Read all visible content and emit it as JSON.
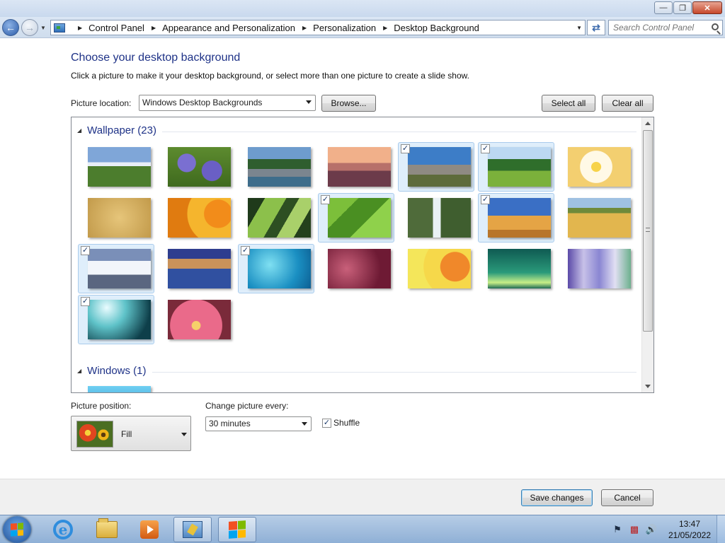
{
  "window": {
    "controls": {
      "minimize": "—",
      "maximize": "❐",
      "close": "✕"
    }
  },
  "address": {
    "breadcrumbs": [
      "Control Panel",
      "Appearance and Personalization",
      "Personalization",
      "Desktop Background"
    ],
    "search_placeholder": "Search Control Panel"
  },
  "page": {
    "title": "Choose your desktop background",
    "subtitle": "Click a picture to make it your desktop background, or select more than one picture to create a slide show.",
    "picture_location_label": "Picture location:",
    "picture_location_value": "Windows Desktop Backgrounds",
    "browse_label": "Browse...",
    "select_all_label": "Select all",
    "clear_all_label": "Clear all"
  },
  "groups": [
    {
      "label": "Wallpaper (23)",
      "items": [
        {
          "name": "stone-circle",
          "checked": false,
          "bg": "linear-gradient(#7fa6d8 0 38%, #e7eef7 38% 48%, #4c7d2d 48% 100%)"
        },
        {
          "name": "bluebells",
          "checked": false,
          "bg": "radial-gradient(circle at 30% 40%, #7a6fd1 0 18%, transparent 19%), radial-gradient(circle at 70% 60%, #6a5fc5 0 20%, transparent 21%), linear-gradient(#5d8b2f, #3f6a1e)"
        },
        {
          "name": "stone-bridge",
          "checked": false,
          "bg": "linear-gradient(#6e9ccd 0 30%, #2f5e2f 30% 55%, #7b858f 55% 75%, #3e6d8b 75%)"
        },
        {
          "name": "pebble-beach",
          "checked": false,
          "bg": "linear-gradient(#f1b08a 0 40%, #b7706a 40% 60%, #6c3b4a 60%)"
        },
        {
          "name": "dolmen",
          "checked": true,
          "bg": "linear-gradient(#3d7dc7 0 45%, #8f8a83 45% 70%, #5e6b3b 70%)"
        },
        {
          "name": "green-valley",
          "checked": true,
          "bg": "linear-gradient(#bcd8f2 0 30%, #2f6e2b 30% 60%, #7bb13b 60%)"
        },
        {
          "name": "frangipani",
          "checked": false,
          "bg": "radial-gradient(circle at 45% 50%, #f7d34a 0 12%, #fff9e6 13% 40%, #f3cf70 41% 100%)"
        },
        {
          "name": "golden-texture",
          "checked": false,
          "bg": "radial-gradient(circle at 50% 50%, #e6c57a, #c29a4a)"
        },
        {
          "name": "orange-flower",
          "checked": false,
          "bg": "radial-gradient(circle at 80% 40%, #f28c1a 0 25%, #f5b52d 26% 55%, #e07b10 56%)"
        },
        {
          "name": "agave-leaves",
          "checked": false,
          "bg": "linear-gradient(120deg, #1f3a1b 0 20%, #8cc04b 20% 45%, #2d4f22 45% 60%, #a9d06a 60% 80%, #24401c 80%)"
        },
        {
          "name": "fern",
          "checked": true,
          "bg": "linear-gradient(135deg, #7cbf3a 0 30%, #4a8f22 30% 60%, #8fd14b 60%)"
        },
        {
          "name": "waterfall",
          "checked": false,
          "bg": "linear-gradient(90deg, #4f6b3a 0 40%, #e9f1f4 40% 52%, #3f5e2f 52%)"
        },
        {
          "name": "desert-dune",
          "checked": true,
          "bg": "linear-gradient(#3a6fc5 0 45%, #e5a445 45% 80%, #b8752a 80%)"
        },
        {
          "name": "wheat-field",
          "checked": false,
          "bg": "linear-gradient(#9fc1e2 0 25%, #6f8a3a 25% 38%, #e2b64e 38%)"
        },
        {
          "name": "snow-mountains",
          "checked": true,
          "bg": "linear-gradient(#7a8fb8 0 30%, #f2f5fa 30% 65%, #5a6680 65%)"
        },
        {
          "name": "mountain-lake",
          "checked": false,
          "bg": "linear-gradient(#2e3d8f 0 25%, #c9925a 25% 50%, #3050a0 50%)"
        },
        {
          "name": "underwater-blue",
          "checked": true,
          "bg": "radial-gradient(circle at 35% 40%, #7fe0f2, #1a8fc2 60%, #0d5f93)"
        },
        {
          "name": "aurora-maroon",
          "checked": false,
          "bg": "radial-gradient(circle at 30% 50%, #c9607a, #6e1a34 70%)"
        },
        {
          "name": "yellow-orange-bokeh",
          "checked": false,
          "bg": "radial-gradient(circle at 75% 45%, #f0882a 0 28%, #f6d84a 29% 60%, #f4e65a 61%)"
        },
        {
          "name": "green-aurora",
          "checked": false,
          "bg": "linear-gradient(#0f5a52, #2a9a7a 60%, #c8ef88 85%, #1f6b55)"
        },
        {
          "name": "purple-stripes",
          "checked": false,
          "bg": "linear-gradient(90deg, #5b4aa8, #c7c1e8, #8a86d2, #e1dff3, #6db08e)"
        },
        {
          "name": "teal-light",
          "checked": true,
          "bg": "radial-gradient(circle at 30% 20%, #eafcff, #5fc3c9 35%, #0e3f4a 80%)"
        },
        {
          "name": "pink-dahlia",
          "checked": false,
          "bg": "radial-gradient(circle at 45% 65%, #f6d06a 0 10%, #ea6a8a 11% 60%, #7a2a3a 61%)"
        }
      ]
    },
    {
      "label": "Windows (1)",
      "items": [
        {
          "name": "windows-default",
          "checked": false,
          "bg": "linear-gradient(#6ecff2, #1f7fc2)"
        }
      ]
    }
  ],
  "options": {
    "position_label": "Picture position:",
    "position_value": "Fill",
    "interval_label": "Change picture every:",
    "interval_value": "30 minutes",
    "shuffle_label": "Shuffle",
    "shuffle_checked": true
  },
  "footer": {
    "save_label": "Save changes",
    "cancel_label": "Cancel"
  },
  "taskbar": {
    "time": "13:47",
    "date": "21/05/2022"
  }
}
